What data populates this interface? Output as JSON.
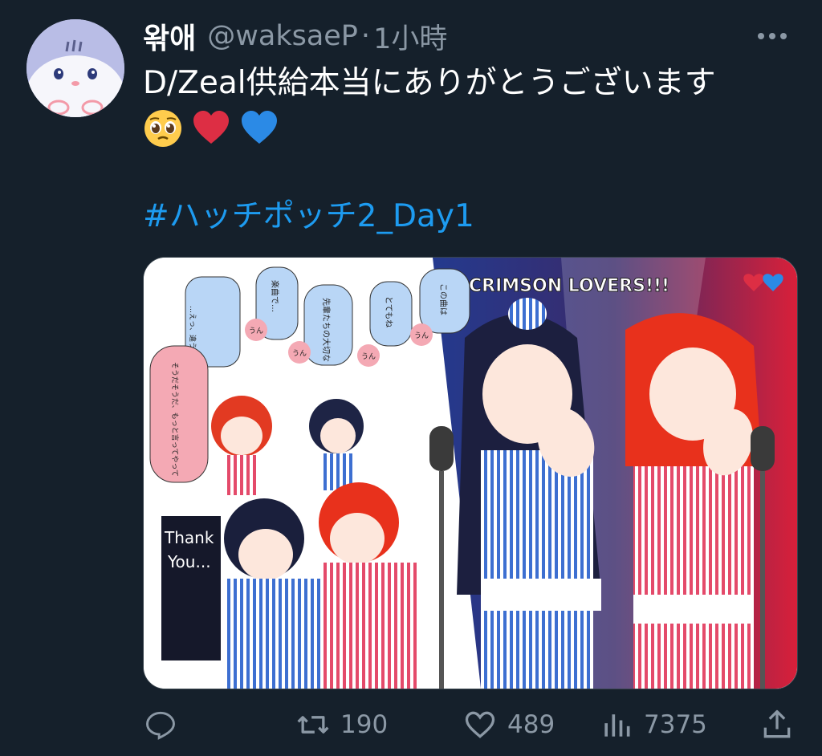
{
  "tweet": {
    "display_name": "왂애",
    "handle": "@waksaeP",
    "separator": "·",
    "time": "1小時",
    "text": "D/Zeal供給本当にありがとうございます",
    "emojis": [
      "pleading-face",
      "red-heart",
      "blue-heart"
    ],
    "hashtag": "#ハッチポッチ2_Day1"
  },
  "media": {
    "title": "CRIMSON LOVERS!!!",
    "bubbles": [
      "楽曲で…",
      "先輩たちの大切な",
      "とてもね",
      "この曲は",
      "…えっ、違うんですか？",
      "そうだそうだ、もっと言ってやって"
    ],
    "small_bubbles": [
      "うん",
      "うん",
      "うん",
      "うん"
    ],
    "board_text": [
      "Thank",
      "You..."
    ]
  },
  "actions": {
    "reply_count": "",
    "retweet_count": "190",
    "like_count": "489",
    "view_count": "7375"
  },
  "colors": {
    "background": "#15202b",
    "accent": "#1d9bf0",
    "secondary_text": "#8b98a5"
  }
}
